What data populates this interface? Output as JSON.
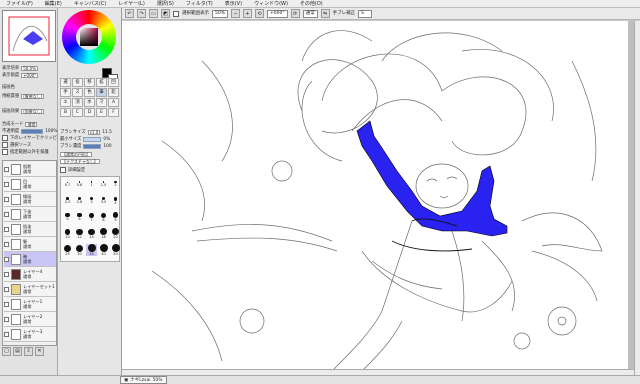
{
  "menu": [
    "ファイル(F)",
    "編集(E)",
    "キャンバス(C)",
    "レイヤー(L)",
    "選択(S)",
    "フィルタ(T)",
    "表示(V)",
    "ウィンドウ(W)",
    "その他(O)"
  ],
  "toolbar": {
    "selection_label": "選択範囲表示",
    "zoom": "50%",
    "angle": "+000°",
    "mode": "通常",
    "stabilizer_label": "手ブレ補正",
    "stabilizer": "S"
  },
  "navigator": {
    "zoom_label": "表示倍率",
    "zoom": "50.0%",
    "angle_label": "表示角度",
    "angle": "+000°"
  },
  "layer_props": {
    "protect_label": "描画色",
    "effect_label": "用紙質感",
    "effect_value": "(質感なし)",
    "effect2_label": "描画効果",
    "effect2_value": "(効果なし)",
    "mode_label": "合成モード",
    "mode": "通常",
    "opacity_label": "不透明度",
    "opacity": "100%",
    "opacity_fraction": 1.0,
    "opt1": "下のレイヤーでクリッピング",
    "opt2": "選択ソース",
    "opt3": "指定範囲以外を保護"
  },
  "layers": [
    {
      "name": "肌影",
      "mode": "通常",
      "thumb": "plain"
    },
    {
      "name": "目",
      "mode": "通常",
      "thumb": "plain"
    },
    {
      "name": "線画",
      "mode": "通常",
      "thumb": "plain"
    },
    {
      "name": "下塗",
      "mode": "通常",
      "thumb": "plain"
    },
    {
      "name": "肌塗",
      "mode": "通常",
      "thumb": "plain"
    },
    {
      "name": "髪",
      "mode": "通常",
      "thumb": "plain"
    },
    {
      "name": "袖",
      "mode": "通常",
      "thumb": "plain"
    },
    {
      "name": "レイヤー4",
      "mode": "通常",
      "thumb": "dark"
    },
    {
      "name": "レイヤーセット1",
      "mode": "通常",
      "thumb": "folder"
    },
    {
      "name": "レイヤー1",
      "mode": "通常",
      "thumb": "plain"
    },
    {
      "name": "レイヤー2",
      "mode": "通常",
      "thumb": "plain"
    },
    {
      "name": "レイヤー3",
      "mode": "通常",
      "thumb": "plain"
    }
  ],
  "active_layer": 6,
  "colors": {
    "primary": "#000000",
    "secondary": "#ffffff",
    "accent_selection": "#c9c5f5",
    "fill_blue": "#2a22f0"
  },
  "tools": [
    "選",
    "投",
    "移",
    "拡",
    "回",
    "手",
    "ス",
    "色",
    "筆",
    "鉛",
    "エ",
    "消",
    "水",
    "マ",
    "A",
    "B",
    "C",
    "D",
    "E",
    "F"
  ],
  "tool_panel": {
    "brush_size_label": "ブラシサイズ",
    "brush_size": "x1.0",
    "brush_size_value": "11.5",
    "min_size_label": "最小サイズ",
    "min_size": "0%",
    "density_label": "ブラシ濃度",
    "density": "100",
    "shape_label": "【通常の円形】",
    "texture_label": "【テクスチャなし】",
    "detail_label": "詳細設定"
  },
  "brush_sizes": [
    "0.7",
    "0.8",
    "1",
    "1.5",
    "2",
    "2.3",
    "2.6",
    "3",
    "3.5",
    "4",
    "5",
    "6",
    "7",
    "8",
    "9",
    "10",
    "12",
    "14",
    "16",
    "20",
    "25",
    "30",
    "35",
    "40",
    "50"
  ],
  "status": {
    "doc_name": "ナギLzsai",
    "doc_zoom": "50%"
  }
}
